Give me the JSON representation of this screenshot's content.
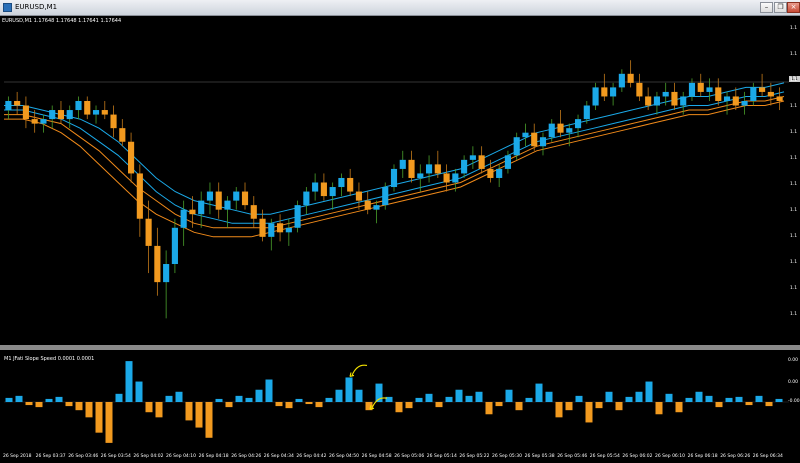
{
  "window": {
    "title": "EURUSD,M1",
    "minimize_glyph": "–",
    "restore_glyph": "❐",
    "close_glyph": "×"
  },
  "chart": {
    "symbol_label": "EURUSD,M1  1.17648 1.17648 1.17641 1.17644",
    "indicator_label": "M1 JFati Slope Speed 0.0001 0.0001",
    "price_axis": [
      "1.1",
      "1.1",
      "1.1",
      "1.1",
      "1.1",
      "1.1",
      "1.1",
      "1.1",
      "1.1",
      "1.1",
      "1.1",
      "1.1"
    ],
    "indicator_axis": [
      "0.00",
      "0.00",
      "-0.00"
    ],
    "time_labels": [
      "26 Sep 2018",
      "26 Sep 03:37",
      "26 Sep 03:46",
      "26 Sep 03:54",
      "26 Sep 04:02",
      "26 Sep 04:10",
      "26 Sep 04:18",
      "26 Sep 04:26",
      "26 Sep 04:34",
      "26 Sep 04:42",
      "26 Sep 04:50",
      "26 Sep 04:58",
      "26 Sep 05:06",
      "26 Sep 05:14",
      "26 Sep 05:22",
      "26 Sep 05:30",
      "26 Sep 05:38",
      "26 Sep 05:46",
      "26 Sep 05:54",
      "26 Sep 06:02",
      "26 Sep 06:10",
      "26 Sep 06:18",
      "26 Sep 06:26",
      "26 Sep 06:34"
    ],
    "colors": {
      "background": "#000000",
      "bull_candle": "#1ba9e8",
      "bear_candle": "#f29a1f",
      "wick_up": "#4aa02c",
      "wick_down": "#c47a1a",
      "doji": "#e8e070",
      "ma_blue": "#1ba9e8",
      "ma_orange": "#f08a1a",
      "annotation": "#f4e200"
    }
  },
  "chart_data": {
    "type": "candlestick",
    "title": "EURUSD,M1",
    "ohlc_header": [
      "1.17648",
      "1.17648",
      "1.17641",
      "1.17644"
    ],
    "candles": [
      [
        1.1776,
        1.1779,
        1.1774,
        1.1778
      ],
      [
        1.1778,
        1.178,
        1.1775,
        1.1777
      ],
      [
        1.1777,
        1.1779,
        1.1772,
        1.1774
      ],
      [
        1.1774,
        1.1776,
        1.1771,
        1.1773
      ],
      [
        1.1773,
        1.1775,
        1.1771,
        1.1774
      ],
      [
        1.1774,
        1.1777,
        1.1772,
        1.1776
      ],
      [
        1.1776,
        1.1778,
        1.1773,
        1.1774
      ],
      [
        1.1774,
        1.1777,
        1.1772,
        1.1776
      ],
      [
        1.1776,
        1.1779,
        1.1774,
        1.1778
      ],
      [
        1.1778,
        1.1779,
        1.1774,
        1.1775
      ],
      [
        1.1775,
        1.1777,
        1.1773,
        1.1776
      ],
      [
        1.1776,
        1.1778,
        1.1774,
        1.1775
      ],
      [
        1.1775,
        1.1777,
        1.177,
        1.1772
      ],
      [
        1.1772,
        1.1774,
        1.1768,
        1.1769
      ],
      [
        1.1769,
        1.1771,
        1.176,
        1.1762
      ],
      [
        1.1762,
        1.1764,
        1.1748,
        1.1752
      ],
      [
        1.1752,
        1.1756,
        1.174,
        1.1746
      ],
      [
        1.1746,
        1.175,
        1.1735,
        1.1738
      ],
      [
        1.1738,
        1.1745,
        1.173,
        1.1742
      ],
      [
        1.1742,
        1.1752,
        1.174,
        1.175
      ],
      [
        1.175,
        1.1756,
        1.1746,
        1.1754
      ],
      [
        1.1754,
        1.1757,
        1.175,
        1.1753
      ],
      [
        1.1753,
        1.1758,
        1.175,
        1.1756
      ],
      [
        1.1756,
        1.176,
        1.1753,
        1.1758
      ],
      [
        1.1758,
        1.176,
        1.1752,
        1.1754
      ],
      [
        1.1754,
        1.1757,
        1.175,
        1.1756
      ],
      [
        1.1756,
        1.1759,
        1.1754,
        1.1758
      ],
      [
        1.1758,
        1.176,
        1.1754,
        1.1755
      ],
      [
        1.1755,
        1.1757,
        1.175,
        1.1752
      ],
      [
        1.1752,
        1.1754,
        1.1747,
        1.1748
      ],
      [
        1.1748,
        1.1752,
        1.1745,
        1.1751
      ],
      [
        1.1751,
        1.1753,
        1.1747,
        1.1749
      ],
      [
        1.1749,
        1.1752,
        1.1746,
        1.175
      ],
      [
        1.175,
        1.1756,
        1.1749,
        1.1755
      ],
      [
        1.1755,
        1.1759,
        1.1753,
        1.1758
      ],
      [
        1.1758,
        1.1762,
        1.1756,
        1.176
      ],
      [
        1.176,
        1.1762,
        1.1756,
        1.1757
      ],
      [
        1.1757,
        1.176,
        1.1754,
        1.1759
      ],
      [
        1.1759,
        1.1762,
        1.1757,
        1.1761
      ],
      [
        1.1761,
        1.1763,
        1.1757,
        1.1758
      ],
      [
        1.1758,
        1.176,
        1.1754,
        1.1756
      ],
      [
        1.1756,
        1.1758,
        1.1753,
        1.1754
      ],
      [
        1.1754,
        1.1756,
        1.1751,
        1.1755
      ],
      [
        1.1755,
        1.176,
        1.1754,
        1.1759
      ],
      [
        1.1759,
        1.1764,
        1.1758,
        1.1763
      ],
      [
        1.1763,
        1.1767,
        1.1761,
        1.1765
      ],
      [
        1.1765,
        1.1767,
        1.176,
        1.1761
      ],
      [
        1.1761,
        1.1764,
        1.1758,
        1.1762
      ],
      [
        1.1762,
        1.1766,
        1.176,
        1.1764
      ],
      [
        1.1764,
        1.1767,
        1.1761,
        1.1762
      ],
      [
        1.1762,
        1.1764,
        1.1758,
        1.176
      ],
      [
        1.176,
        1.1763,
        1.1758,
        1.1762
      ],
      [
        1.1762,
        1.1766,
        1.1761,
        1.1765
      ],
      [
        1.1765,
        1.1768,
        1.1763,
        1.1766
      ],
      [
        1.1766,
        1.1768,
        1.1762,
        1.1763
      ],
      [
        1.1763,
        1.1765,
        1.176,
        1.1761
      ],
      [
        1.1761,
        1.1764,
        1.1759,
        1.1763
      ],
      [
        1.1763,
        1.1767,
        1.1762,
        1.1766
      ],
      [
        1.1766,
        1.1771,
        1.1765,
        1.177
      ],
      [
        1.177,
        1.1773,
        1.1768,
        1.1771
      ],
      [
        1.1771,
        1.1773,
        1.1767,
        1.1768
      ],
      [
        1.1768,
        1.1771,
        1.1766,
        1.177
      ],
      [
        1.177,
        1.1774,
        1.1769,
        1.1773
      ],
      [
        1.1773,
        1.1776,
        1.177,
        1.1771
      ],
      [
        1.1771,
        1.1773,
        1.1768,
        1.1772
      ],
      [
        1.1772,
        1.1775,
        1.177,
        1.1774
      ],
      [
        1.1774,
        1.1778,
        1.1773,
        1.1777
      ],
      [
        1.1777,
        1.1782,
        1.1776,
        1.1781
      ],
      [
        1.1781,
        1.1784,
        1.1778,
        1.1779
      ],
      [
        1.1779,
        1.1782,
        1.1777,
        1.1781
      ],
      [
        1.1781,
        1.1785,
        1.178,
        1.1784
      ],
      [
        1.1784,
        1.1787,
        1.1781,
        1.1782
      ],
      [
        1.1782,
        1.1784,
        1.1778,
        1.1779
      ],
      [
        1.1779,
        1.1781,
        1.1776,
        1.1777
      ],
      [
        1.1777,
        1.178,
        1.1775,
        1.1779
      ],
      [
        1.1779,
        1.1782,
        1.1777,
        1.178
      ],
      [
        1.178,
        1.1782,
        1.1776,
        1.1777
      ],
      [
        1.1777,
        1.178,
        1.1775,
        1.1779
      ],
      [
        1.1779,
        1.1783,
        1.1778,
        1.1782
      ],
      [
        1.1782,
        1.1784,
        1.1779,
        1.178
      ],
      [
        1.178,
        1.1783,
        1.1778,
        1.1781
      ],
      [
        1.1781,
        1.1783,
        1.1777,
        1.1778
      ],
      [
        1.1778,
        1.178,
        1.1775,
        1.1779
      ],
      [
        1.1779,
        1.1781,
        1.1776,
        1.1777
      ],
      [
        1.1777,
        1.178,
        1.1775,
        1.1778
      ],
      [
        1.1778,
        1.1782,
        1.1777,
        1.1781
      ],
      [
        1.1781,
        1.1784,
        1.1779,
        1.178
      ],
      [
        1.178,
        1.1782,
        1.1777,
        1.1779
      ],
      [
        1.1779,
        1.1781,
        1.1776,
        1.1778
      ]
    ],
    "ma_series": [
      {
        "color_key": "ma_blue",
        "values": [
          1.1777,
          1.1777,
          1.1776,
          1.1775,
          1.1774,
          1.1772,
          1.1769,
          1.1765,
          1.1761,
          1.1758,
          1.1756,
          1.1755,
          1.1754,
          1.1753,
          1.1753,
          1.1754,
          1.1755,
          1.1756,
          1.1757,
          1.1758,
          1.1759,
          1.176,
          1.1761,
          1.1762,
          1.1763,
          1.1765,
          1.1767,
          1.1769,
          1.1771,
          1.1772,
          1.1773,
          1.1774,
          1.1775,
          1.1776,
          1.1777,
          1.1778,
          1.1779,
          1.1779,
          1.178,
          1.1781,
          1.1781,
          1.1782
        ]
      },
      {
        "color_key": "ma_blue",
        "values": [
          1.1776,
          1.1776,
          1.1775,
          1.1774,
          1.1772,
          1.1769,
          1.1766,
          1.1762,
          1.1758,
          1.1755,
          1.1753,
          1.1752,
          1.1751,
          1.1751,
          1.1751,
          1.1752,
          1.1753,
          1.1754,
          1.1755,
          1.1756,
          1.1757,
          1.1758,
          1.1759,
          1.176,
          1.1761,
          1.1763,
          1.1765,
          1.1767,
          1.1769,
          1.177,
          1.1771,
          1.1772,
          1.1773,
          1.1774,
          1.1775,
          1.1776,
          1.1777,
          1.1777,
          1.1778,
          1.1779,
          1.1779,
          1.178
        ]
      },
      {
        "color_key": "ma_orange",
        "values": [
          1.1775,
          1.1775,
          1.1774,
          1.1773,
          1.177,
          1.1767,
          1.1763,
          1.1759,
          1.1756,
          1.1753,
          1.1751,
          1.175,
          1.175,
          1.175,
          1.175,
          1.1751,
          1.1752,
          1.1753,
          1.1754,
          1.1755,
          1.1756,
          1.1757,
          1.1758,
          1.1759,
          1.176,
          1.1762,
          1.1764,
          1.1766,
          1.1768,
          1.1769,
          1.177,
          1.1771,
          1.1772,
          1.1773,
          1.1774,
          1.1775,
          1.1776,
          1.1776,
          1.1777,
          1.1778,
          1.1778,
          1.1779
        ]
      },
      {
        "color_key": "ma_orange",
        "values": [
          1.1774,
          1.1774,
          1.1773,
          1.1771,
          1.1768,
          1.1764,
          1.176,
          1.1756,
          1.1753,
          1.1751,
          1.1749,
          1.1748,
          1.1748,
          1.1748,
          1.1749,
          1.175,
          1.1751,
          1.1752,
          1.1753,
          1.1754,
          1.1755,
          1.1756,
          1.1757,
          1.1758,
          1.1759,
          1.1761,
          1.1763,
          1.1765,
          1.1767,
          1.1768,
          1.1769,
          1.177,
          1.1771,
          1.1772,
          1.1773,
          1.1774,
          1.1775,
          1.1775,
          1.1776,
          1.1777,
          1.1777,
          1.1778
        ]
      }
    ],
    "ylim": [
      1.1725,
      1.1795
    ],
    "indicator": {
      "type": "histogram",
      "ylim": [
        -0.00045,
        0.00045
      ],
      "values": [
        4e-05,
        6e-05,
        -3e-05,
        -5e-05,
        3e-05,
        5e-05,
        -4e-05,
        -8e-05,
        -0.00015,
        -0.0003,
        -0.0004,
        8e-05,
        0.0004,
        0.0002,
        -0.0001,
        -0.00015,
        6e-05,
        0.0001,
        -0.00018,
        -0.00025,
        -0.00035,
        3e-05,
        -5e-05,
        6e-05,
        4e-05,
        0.00012,
        0.00022,
        -4e-05,
        -6e-05,
        3e-05,
        -2e-05,
        -5e-05,
        4e-05,
        0.00012,
        0.00024,
        0.00012,
        -8e-05,
        0.00018,
        5e-05,
        -0.0001,
        -6e-05,
        4e-05,
        8e-05,
        -5e-05,
        5e-05,
        0.00012,
        6e-05,
        0.0001,
        -0.00012,
        -4e-05,
        0.00012,
        -8e-05,
        4e-05,
        0.00018,
        0.0001,
        -0.00015,
        -8e-05,
        6e-05,
        -0.0002,
        -6e-05,
        0.0001,
        -8e-05,
        5e-05,
        0.0001,
        0.0002,
        -0.00012,
        8e-05,
        -0.0001,
        4e-05,
        0.0001,
        6e-05,
        -5e-05,
        4e-05,
        5e-05,
        -3e-05,
        6e-05,
        -4e-05,
        3e-05
      ]
    },
    "annotations": [
      {
        "type": "arrow",
        "color_key": "annotation",
        "target_bar": 34
      },
      {
        "type": "arrow",
        "color_key": "annotation",
        "target_bar": 36
      }
    ]
  }
}
